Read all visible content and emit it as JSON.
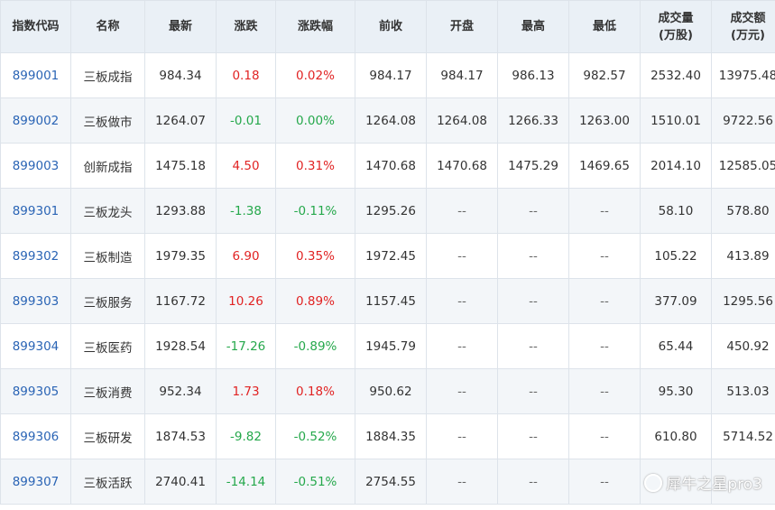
{
  "colors": {
    "up": "#e12323",
    "down": "#25a84b",
    "code": "#2a64b5",
    "header_bg": "#eaf0f6"
  },
  "headers": [
    {
      "label": "指数代码"
    },
    {
      "label": "名称"
    },
    {
      "label": "最新"
    },
    {
      "label": "涨跌"
    },
    {
      "label": "涨跌幅"
    },
    {
      "label": "前收"
    },
    {
      "label": "开盘"
    },
    {
      "label": "最高"
    },
    {
      "label": "最低"
    },
    {
      "label": "成交量",
      "sub": "(万股)"
    },
    {
      "label": "成交额",
      "sub": "(万元)"
    }
  ],
  "rows": [
    {
      "code": "899001",
      "name": "三板成指",
      "latest": "984.34",
      "change": "0.18",
      "pct": "0.02%",
      "prev": "984.17",
      "open": "984.17",
      "high": "986.13",
      "low": "982.57",
      "volume": "2532.40",
      "amount": "13975.48",
      "dir": "up"
    },
    {
      "code": "899002",
      "name": "三板做市",
      "latest": "1264.07",
      "change": "-0.01",
      "pct": "0.00%",
      "prev": "1264.08",
      "open": "1264.08",
      "high": "1266.33",
      "low": "1263.00",
      "volume": "1510.01",
      "amount": "9722.56",
      "dir": "down"
    },
    {
      "code": "899003",
      "name": "创新成指",
      "latest": "1475.18",
      "change": "4.50",
      "pct": "0.31%",
      "prev": "1470.68",
      "open": "1470.68",
      "high": "1475.29",
      "low": "1469.65",
      "volume": "2014.10",
      "amount": "12585.05",
      "dir": "up"
    },
    {
      "code": "899301",
      "name": "三板龙头",
      "latest": "1293.88",
      "change": "-1.38",
      "pct": "-0.11%",
      "prev": "1295.26",
      "open": "--",
      "high": "--",
      "low": "--",
      "volume": "58.10",
      "amount": "578.80",
      "dir": "down"
    },
    {
      "code": "899302",
      "name": "三板制造",
      "latest": "1979.35",
      "change": "6.90",
      "pct": "0.35%",
      "prev": "1972.45",
      "open": "--",
      "high": "--",
      "low": "--",
      "volume": "105.22",
      "amount": "413.89",
      "dir": "up"
    },
    {
      "code": "899303",
      "name": "三板服务",
      "latest": "1167.72",
      "change": "10.26",
      "pct": "0.89%",
      "prev": "1157.45",
      "open": "--",
      "high": "--",
      "low": "--",
      "volume": "377.09",
      "amount": "1295.56",
      "dir": "up"
    },
    {
      "code": "899304",
      "name": "三板医药",
      "latest": "1928.54",
      "change": "-17.26",
      "pct": "-0.89%",
      "prev": "1945.79",
      "open": "--",
      "high": "--",
      "low": "--",
      "volume": "65.44",
      "amount": "450.92",
      "dir": "down"
    },
    {
      "code": "899305",
      "name": "三板消费",
      "latest": "952.34",
      "change": "1.73",
      "pct": "0.18%",
      "prev": "950.62",
      "open": "--",
      "high": "--",
      "low": "--",
      "volume": "95.30",
      "amount": "513.03",
      "dir": "up"
    },
    {
      "code": "899306",
      "name": "三板研发",
      "latest": "1874.53",
      "change": "-9.82",
      "pct": "-0.52%",
      "prev": "1884.35",
      "open": "--",
      "high": "--",
      "low": "--",
      "volume": "610.80",
      "amount": "5714.52",
      "dir": "down"
    },
    {
      "code": "899307",
      "name": "三板活跃",
      "latest": "2740.41",
      "change": "-14.14",
      "pct": "-0.51%",
      "prev": "2754.55",
      "open": "--",
      "high": "--",
      "low": "--",
      "volume": "",
      "amount": "",
      "dir": "down"
    }
  ],
  "watermark": {
    "text": "犀牛之星pro3",
    "icon": "camera-icon"
  }
}
